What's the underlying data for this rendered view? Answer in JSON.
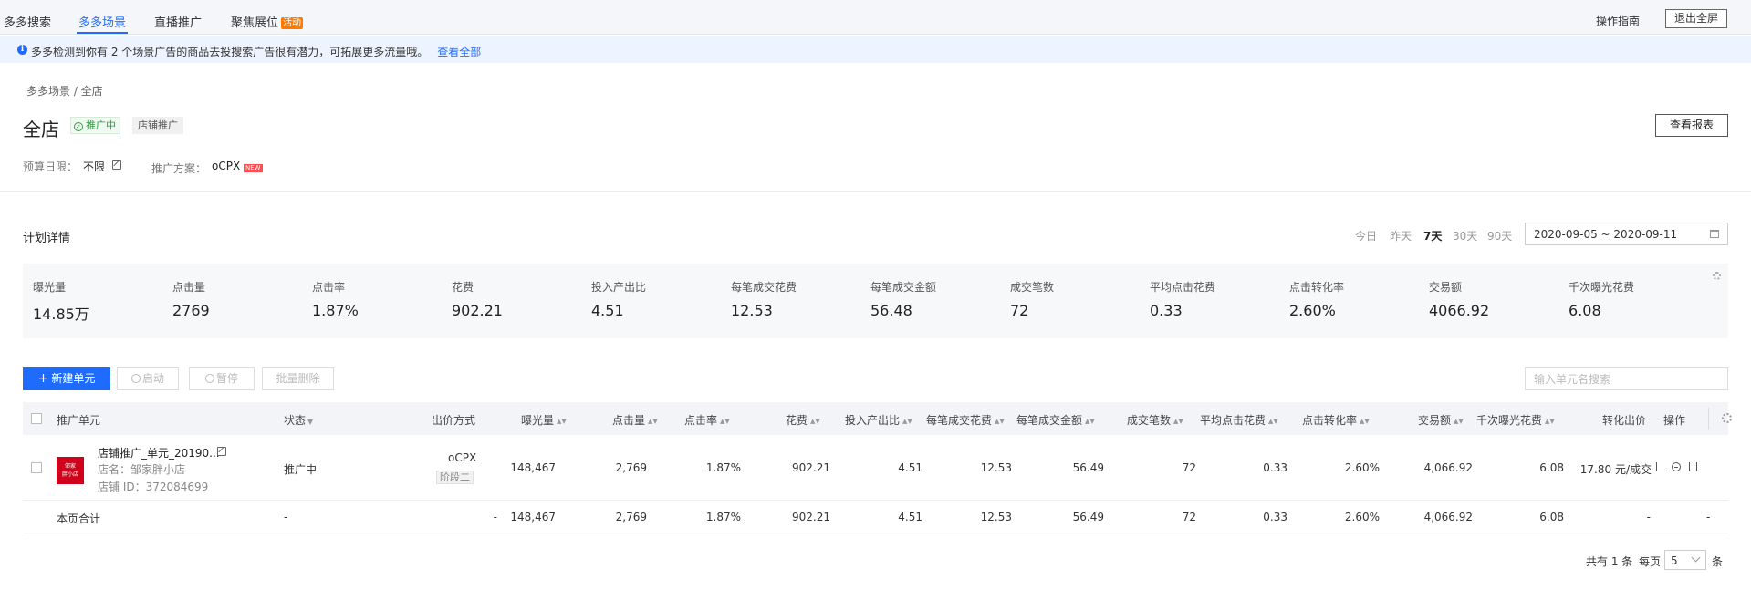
{
  "top_tabs": [
    "多多搜索",
    "多多场景",
    "直播推广",
    "聚焦展位"
  ],
  "activity_badge": "活动",
  "guide_link": "操作指南",
  "exit_fullscreen": "退出全屏",
  "notice": {
    "text": "多多检测到你有 2 个场景广告的商品去投搜索广告很有潜力，可拓展更多流量哦。",
    "link": "查看全部"
  },
  "breadcrumb": "多多场景 / 全店",
  "title": "全店",
  "status_tag": "推广中",
  "type_tag": "店铺推广",
  "report_button": "查看报表",
  "budget": {
    "label": "预算日限：",
    "value": "不限"
  },
  "plan": {
    "label": "推广方案：",
    "value": "oCPX",
    "badge": "NEW"
  },
  "section_title": "计划详情",
  "ranges": [
    "今日",
    "昨天",
    "7天",
    "30天",
    "90天"
  ],
  "active_range": "7天",
  "date_range": "2020-09-05 ~ 2020-09-11",
  "stats": [
    {
      "label": "曝光量",
      "value": "14.85万"
    },
    {
      "label": "点击量",
      "value": "2769"
    },
    {
      "label": "点击率",
      "value": "1.87%"
    },
    {
      "label": "花费",
      "value": "902.21"
    },
    {
      "label": "投入产出比",
      "value": "4.51"
    },
    {
      "label": "每笔成交花费",
      "value": "12.53"
    },
    {
      "label": "每笔成交金额",
      "value": "56.48"
    },
    {
      "label": "成交笔数",
      "value": "72"
    },
    {
      "label": "平均点击花费",
      "value": "0.33"
    },
    {
      "label": "点击转化率",
      "value": "2.60%"
    },
    {
      "label": "交易额",
      "value": "4066.92"
    },
    {
      "label": "千次曝光花费",
      "value": "6.08"
    }
  ],
  "toolbar": {
    "new_unit": "新建单元",
    "start": "启动",
    "pause": "暂停",
    "batch_delete": "批量删除",
    "search_placeholder": "输入单元名搜索"
  },
  "columns": [
    "推广单元",
    "状态",
    "出价方式",
    "曝光量",
    "点击量",
    "点击率",
    "花费",
    "投入产出比",
    "每笔成交花费",
    "每笔成交金额",
    "成交笔数",
    "平均点击花费",
    "点击转化率",
    "交易额",
    "千次曝光花费",
    "转化出价",
    "操作"
  ],
  "row": {
    "logo_text": [
      "邹家",
      "胖小店"
    ],
    "unit_name": "店铺推广_单元_20190...",
    "shop_name": "店名：邹家胖小店",
    "shop_id": "店铺 ID：372084699",
    "status": "推广中",
    "bid": "oCPX",
    "stage": "阶段二",
    "values": [
      "148,467",
      "2,769",
      "1.87%",
      "902.21",
      "4.51",
      "12.53",
      "56.49",
      "72",
      "0.33",
      "2.60%",
      "4,066.92",
      "6.08"
    ],
    "conv_bid": "17.80 元/成交"
  },
  "total_row": {
    "label": "本页合计",
    "status": "-",
    "bid": "-",
    "values": [
      "148,467",
      "2,769",
      "1.87%",
      "902.21",
      "4.51",
      "12.53",
      "56.49",
      "72",
      "0.33",
      "2.60%",
      "4,066.92",
      "6.08"
    ],
    "conv_bid": "-",
    "op": "-"
  },
  "pagination": {
    "total": "共有 1 条",
    "per_page_label": "每页",
    "page_size": "5",
    "unit": "条"
  }
}
